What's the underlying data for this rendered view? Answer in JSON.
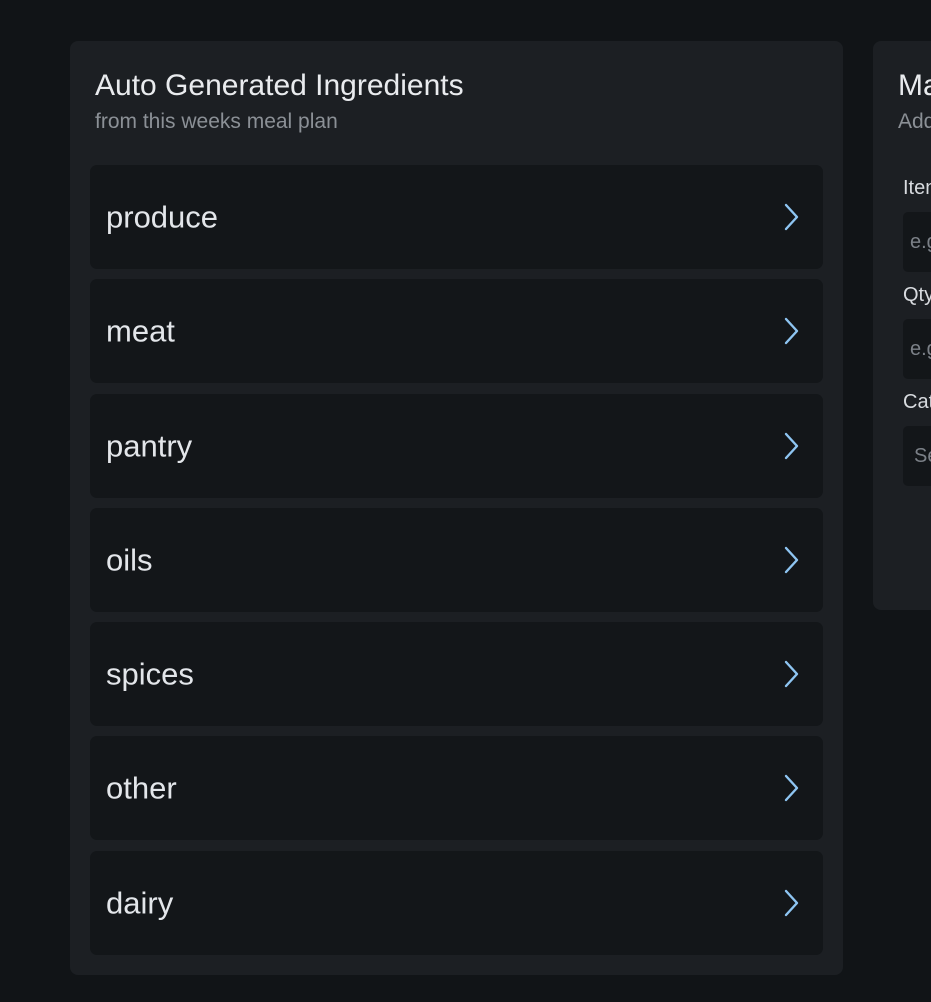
{
  "auto_ingredients": {
    "title": "Auto Generated Ingredients",
    "subtitle": "from this weeks meal plan",
    "categories": [
      {
        "label": "produce"
      },
      {
        "label": "meat"
      },
      {
        "label": "pantry"
      },
      {
        "label": "oils"
      },
      {
        "label": "spices"
      },
      {
        "label": "other"
      },
      {
        "label": "dairy"
      }
    ]
  },
  "manual_item": {
    "title": "Ma",
    "subtitle": "Add",
    "fields": {
      "item_label": "Item",
      "item_placeholder": "e.g",
      "qty_label": "Qty",
      "qty_placeholder": "e.g",
      "category_label": "Cat",
      "category_placeholder": "Se"
    }
  },
  "colors": {
    "page_background": "#111417",
    "card_background": "#1c1f23",
    "row_background": "#131619",
    "chevron_accent": "#8ec5f2"
  },
  "icons": {
    "row_chevron": "chevron-right-icon"
  }
}
